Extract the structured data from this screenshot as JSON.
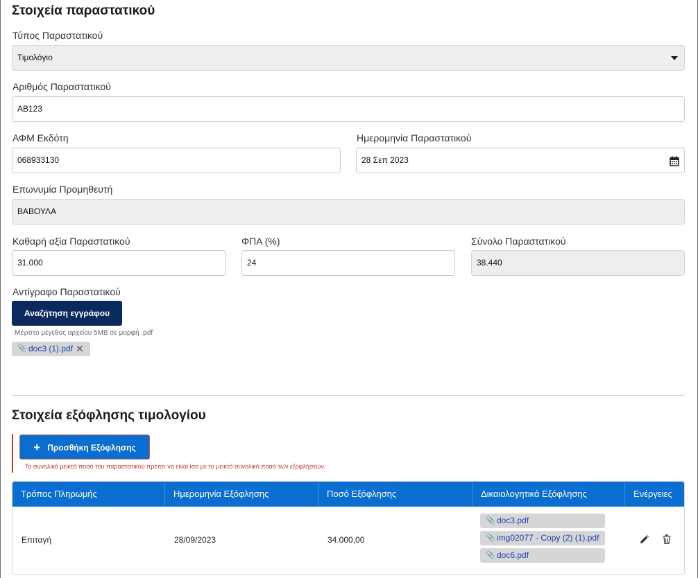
{
  "invoice": {
    "title": "Στοιχεία παραστατικού",
    "type_label": "Τύπος Παραστατικού",
    "type_value": "Τιμολόγιο",
    "number_label": "Αριθμός Παραστατικού",
    "number_value": "ΑΒ123",
    "afm_label": "ΑΦΜ Εκδότη",
    "afm_value": "068933130",
    "date_label": "Ημερομηνία Παραστατικού",
    "date_value": "28 Σεπ 2023",
    "supplier_label": "Επωνυμία Προμηθευτή",
    "supplier_value": "ΒΑΒΟΥΛΑ",
    "net_label": "Καθαρή αξία Παραστατικού",
    "net_value": "31.000",
    "vat_label": "ΦΠΑ (%)",
    "vat_value": "24",
    "total_label": "Σύνολο Παραστατικού",
    "total_value": "38.440",
    "copy_label": "Αντίγραφο Παραστατικού",
    "search_button": "Αναζήτηση εγγράφου",
    "file_hint": "Μέγιστο μέγεθος αρχείου 5MB σε μορφή .pdf",
    "attached_file": "doc3 (1).pdf"
  },
  "payment": {
    "title": "Στοιχεία εξόφλησης τιμολογίου",
    "add_button": "Προσθήκη Εξόφλησης",
    "error": "Το συνολικό μεικτό ποσό του παραστατικού πρέπει να είναι ίσο με το μεικτό συνολικό ποσό των εξοφλήσεων.",
    "columns": [
      "Τρόπος Πληρωμής",
      "Ημερομηνία Εξόφλησης",
      "Ποσό Εξόφλησης",
      "Δικαιολογητικά Εξόφλησης",
      "Ενέργειες"
    ],
    "rows": [
      {
        "method": "Επιταγή",
        "date": "28/09/2023",
        "amount": "34.000,00",
        "files": [
          "doc3.pdf",
          "img02077 - Copy (2) (1).pdf",
          "doc6.pdf"
        ]
      }
    ]
  },
  "icons": {
    "dropdown": "chevron-down-icon",
    "calendar": "calendar-icon",
    "attachment": "paperclip-icon",
    "remove": "close-icon",
    "add": "plus-icon",
    "edit": "pencil-icon",
    "delete": "trash-icon"
  }
}
